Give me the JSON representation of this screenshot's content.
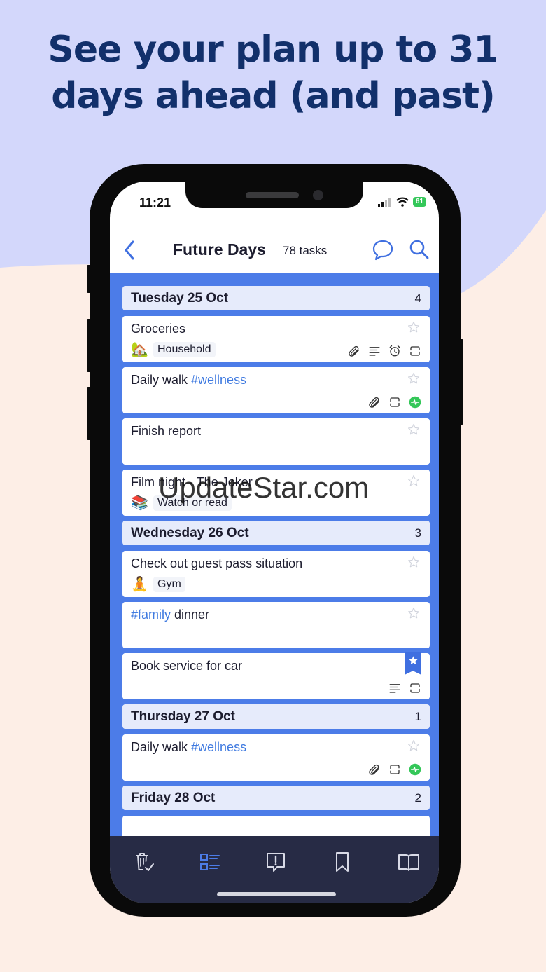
{
  "headline": {
    "line1": "See your plan up to 31",
    "line2": "days ahead (and past)"
  },
  "status_bar": {
    "time": "11:21",
    "battery": "61"
  },
  "nav": {
    "title": "Future Days",
    "count": "78 tasks"
  },
  "days": [
    {
      "name": "Tuesday 25 Oct",
      "count": "4",
      "tasks": [
        {
          "title": "Groceries",
          "project_emoji": "🏡",
          "project": "Household",
          "icons": [
            "paperclip-icon",
            "notes-icon",
            "alarm-icon",
            "repeat-icon"
          ]
        },
        {
          "title_plain": "Daily walk ",
          "tag": "#wellness",
          "icons": [
            "paperclip-icon",
            "repeat-icon",
            "health-icon"
          ]
        },
        {
          "title": "Finish report"
        },
        {
          "title": "Film night - The Joker",
          "project_emoji": "📚",
          "project": "Watch or read"
        }
      ]
    },
    {
      "name": "Wednesday 26 Oct",
      "count": "3",
      "tasks": [
        {
          "title": "Check out guest pass situation",
          "project_emoji": "🧘",
          "project": "Gym"
        },
        {
          "tag": "#family",
          "title_after": " dinner"
        },
        {
          "title": "Book service for car",
          "starred": true,
          "icons": [
            "notes-icon",
            "repeat-icon"
          ]
        }
      ]
    },
    {
      "name": "Thursday 27 Oct",
      "count": "1",
      "tasks": [
        {
          "title_plain": "Daily walk ",
          "tag": "#wellness",
          "icons": [
            "paperclip-icon",
            "repeat-icon",
            "health-icon"
          ]
        }
      ]
    },
    {
      "name": "Friday 28 Oct",
      "count": "2"
    }
  ],
  "tabs": [
    "trash-check-icon",
    "list-icon",
    "alert-bubble-icon",
    "bookmark-icon",
    "book-icon"
  ],
  "watermark": "UpdateStar.com",
  "colors": {
    "accent": "#3f7ae0",
    "list_bg": "#4c7ce8",
    "header_bg": "#e6ebfb",
    "tabbar_bg": "#272b45",
    "headline": "#12306b"
  }
}
